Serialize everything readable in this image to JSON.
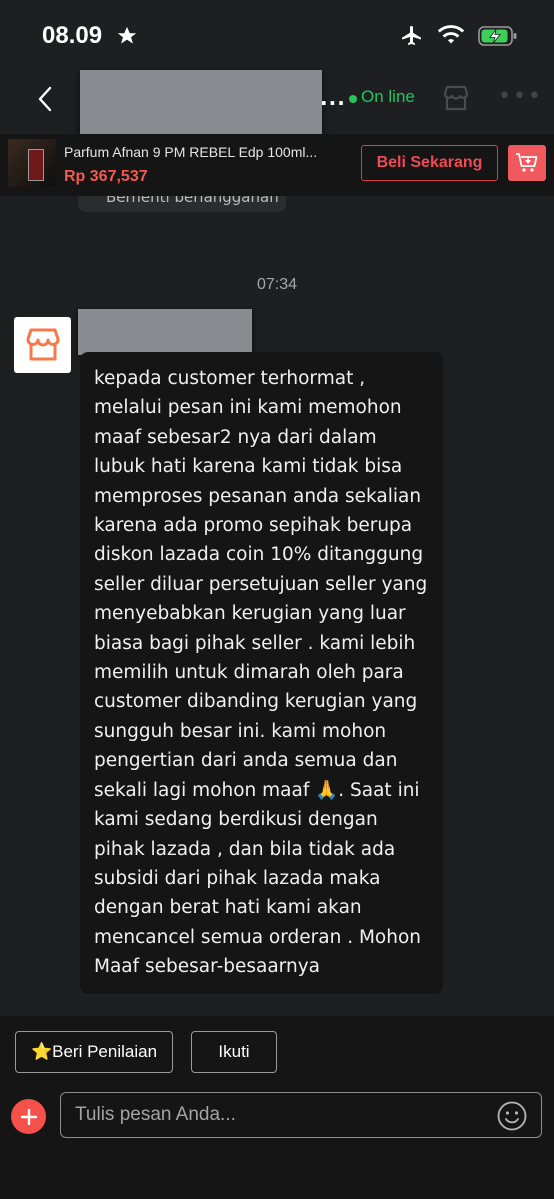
{
  "status_bar": {
    "time": "08.09"
  },
  "header": {
    "name_suffix": "...",
    "online_label": "On line"
  },
  "product": {
    "title": "Parfum Afnan 9 PM REBEL Edp 100ml...",
    "price": "Rp 367,537",
    "buy_label": "Beli Sekarang"
  },
  "chat": {
    "partial_chip_text": "Berhenti berlangganan",
    "timestamp": "07:34",
    "message": "kepada customer terhormat ,\nmelalui pesan ini kami memohon\nmaaf sebesar2 nya dari dalam\nlubuk hati karena kami tidak bisa\nmemproses pesanan anda sekalian\nkarena ada promo sepihak berupa\ndiskon lazada coin 10% ditanggung\nseller diluar persetujuan seller yang\nmenyebabkan kerugian yang luar\nbiasa bagi pihak seller . kami lebih\nmemilih untuk dimarah oleh para\ncustomer dibanding kerugian yang\nsungguh besar ini. kami mohon\npengertian dari anda semua dan\nsekali lagi mohon maaf 🙏. Saat ini\nkami sedang berdikusi dengan\npihak lazada , dan bila tidak ada\nsubsidi dari pihak lazada maka\ndengan berat hati kami akan\nmencancel semua orderan . Mohon\nMaaf sebesar-besaarnya"
  },
  "footer": {
    "rate_label": "⭐Beri Penilaian",
    "follow_label": "Ikuti",
    "input_placeholder": "Tulis pesan Anda..."
  },
  "icons": {
    "status": [
      "star-icon",
      "airplane-icon",
      "wifi-icon",
      "battery-charging-icon"
    ],
    "header": [
      "back-chevron-icon",
      "store-icon",
      "more-icon"
    ],
    "product": [
      "cart-add-icon"
    ],
    "footer": [
      "plus-icon",
      "emoji-icon"
    ]
  },
  "colors": {
    "background": "#1e1f21",
    "bubble": "#151516",
    "online": "#22c55e",
    "accent": "#f05a4f",
    "buy_border": "#d63f4a",
    "battery": "#3ecf5a"
  }
}
